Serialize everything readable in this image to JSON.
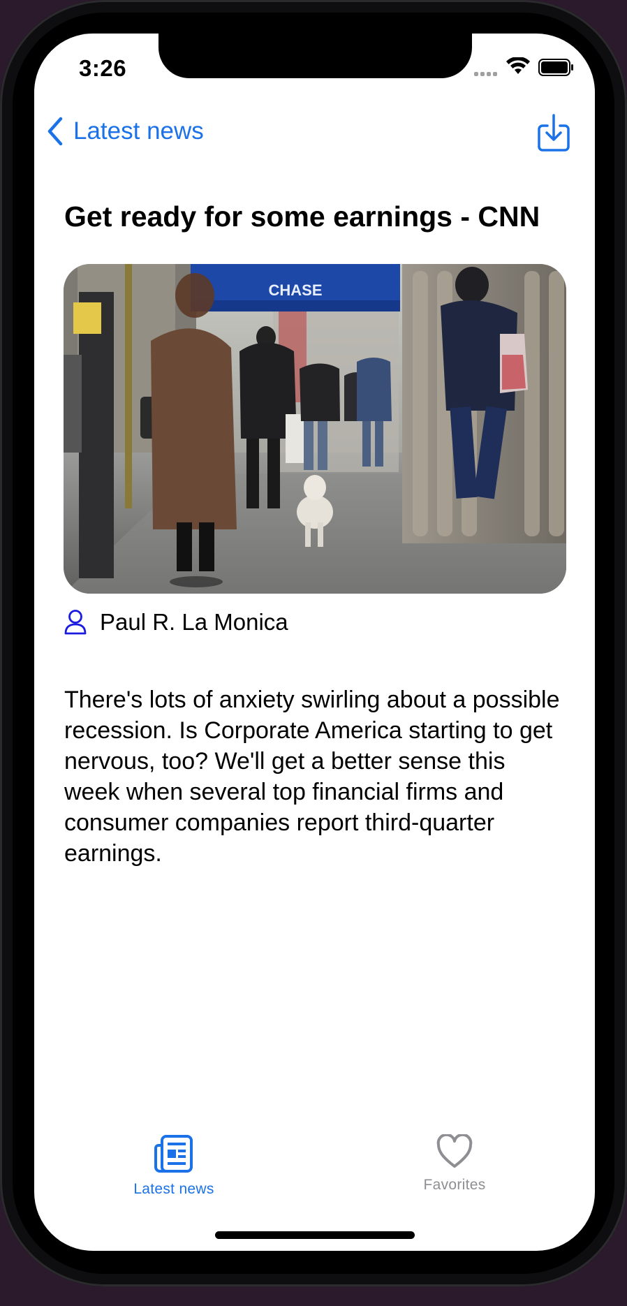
{
  "status_bar": {
    "time": "3:26"
  },
  "nav": {
    "back_label": "Latest news",
    "share_icon": "share-download-icon"
  },
  "article": {
    "title": "Get ready for some earnings - CNN",
    "image_sign_text": "CHASE",
    "author": "Paul R. La Monica",
    "body": "There's lots of anxiety swirling about a possible recession. Is Corporate America starting to get nervous, too? We'll get a better sense this week when several top financial firms and consumer companies report third-quarter earnings."
  },
  "tabs": [
    {
      "label": "Latest news",
      "icon": "newspaper-icon",
      "active": true
    },
    {
      "label": "Favorites",
      "icon": "heart-icon",
      "active": false
    }
  ],
  "colors": {
    "accent": "#1b72e8",
    "inactive": "#8e8e93",
    "author_icon": "#1a1ae0"
  }
}
